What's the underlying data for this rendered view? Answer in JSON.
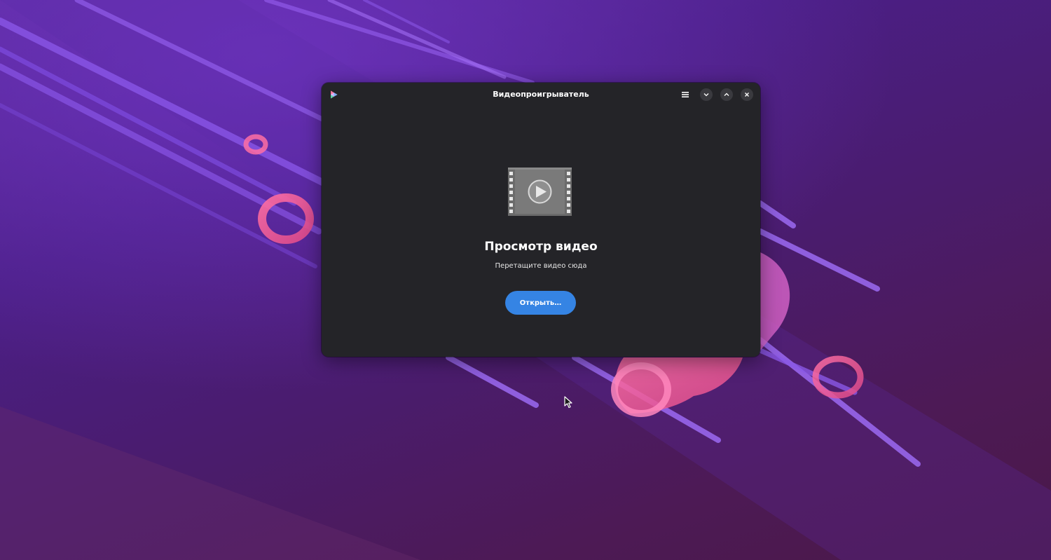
{
  "window": {
    "title": "Видеопроигрыватель",
    "app_icon": "video-player-app-icon",
    "controls": {
      "menu_icon": "hamburger-menu-icon",
      "minimize_icon": "chevron-down-icon",
      "maximize_icon": "chevron-up-icon",
      "close_icon": "close-icon"
    }
  },
  "main": {
    "placeholder_icon": "video-film-icon",
    "heading": "Просмотр видео",
    "subtitle": "Перетащите видео сюда",
    "open_button_label": "Открыть…"
  },
  "colors": {
    "accent": "#3584e4",
    "window_bg": "#242428"
  }
}
